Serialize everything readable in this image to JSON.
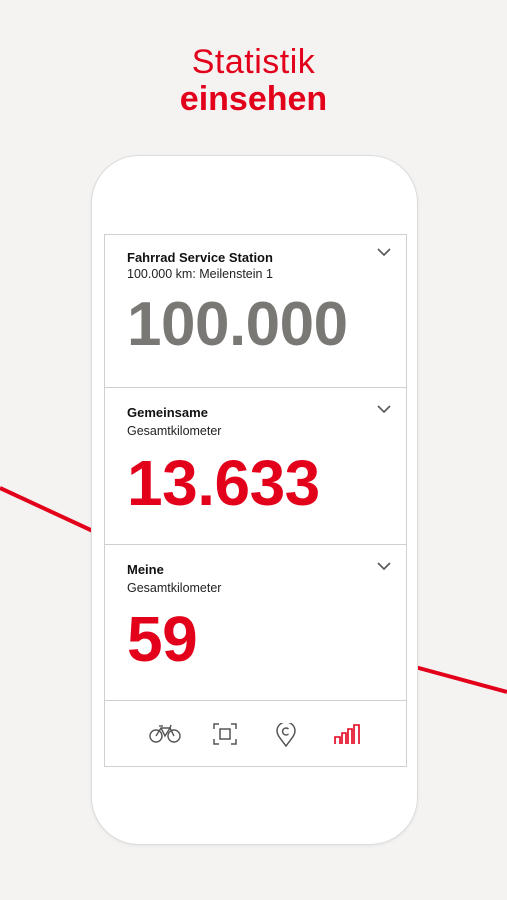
{
  "headline": {
    "line1": "Statistik",
    "line2": "einsehen"
  },
  "cards": [
    {
      "title": "Fahrrad Service Station",
      "subtitle": "100.000 km: Meilenstein 1",
      "value": "100.000",
      "value_color": "#7a7874"
    },
    {
      "title": "Gemeinsame",
      "subtitle": "Gesamtkilometer",
      "value": "13.633",
      "value_color": "#e3001b"
    },
    {
      "title": "Meine",
      "subtitle": "Gesamtkilometer",
      "value": "59",
      "value_color": "#e3001b"
    }
  ],
  "nav": {
    "items": [
      "bike-icon",
      "scan-icon",
      "location-pin-icon",
      "statistics-icon"
    ],
    "active": "statistics-icon"
  },
  "colors": {
    "accent": "#e3001b",
    "background": "#f4f3f1",
    "muted": "#7a7874"
  }
}
